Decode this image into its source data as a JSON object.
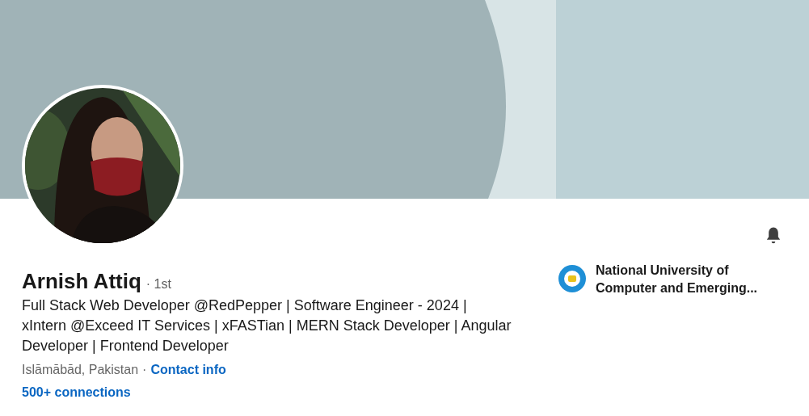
{
  "profile": {
    "name": "Arnish Attiq",
    "degree": "· 1st",
    "headline": "Full Stack Web Developer @RedPepper | Software Engineer - 2024 | xIntern @Exceed IT Services | xFASTian | MERN Stack Developer | Angular Developer | Frontend Developer",
    "location": "Islāmābād, Pakistan",
    "separator": "·",
    "contact_link": "Contact info",
    "connections": "500+ connections"
  },
  "education": {
    "school": "National University of Computer and Emerging..."
  }
}
